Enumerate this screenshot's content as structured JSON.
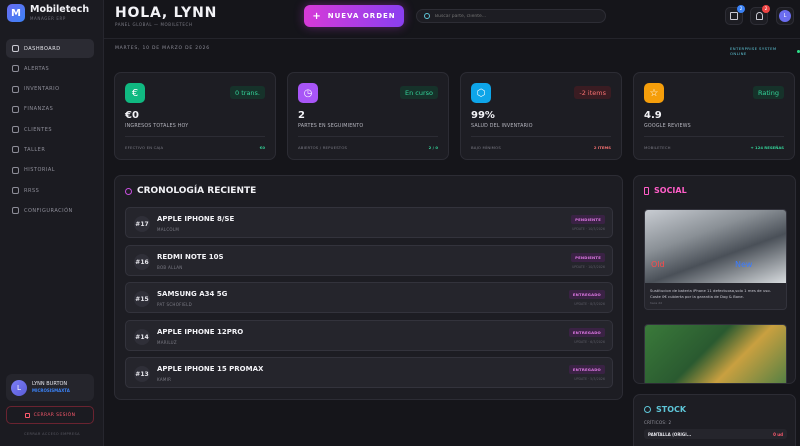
{
  "brand": {
    "logo_letter": "M",
    "name": "Mobiletech",
    "subtitle": "MANAGER ERP"
  },
  "sidebar": {
    "items": [
      {
        "label": "DASHBOARD",
        "icon": "grid-icon",
        "active": true
      },
      {
        "label": "ALERTAS",
        "icon": "bell-icon",
        "active": false
      },
      {
        "label": "INVENTARIO",
        "icon": "box-icon",
        "active": false
      },
      {
        "label": "FINANZAS",
        "icon": "euro-icon",
        "active": false
      },
      {
        "label": "CLIENTES",
        "icon": "users-icon",
        "active": false
      },
      {
        "label": "TALLER",
        "icon": "wrench-icon",
        "active": false
      },
      {
        "label": "HISTORIAL",
        "icon": "history-icon",
        "active": false
      },
      {
        "label": "RRSS",
        "icon": "share-icon",
        "active": false
      },
      {
        "label": "CONFIGURACIÓN",
        "icon": "gear-icon",
        "active": false
      }
    ],
    "user": {
      "initial": "L",
      "name": "LYNN BURTON",
      "role": "MICROSISMAXTA"
    },
    "logout_label": "CERRAR SESIÓN",
    "footnote": "CERRAR ACCESO EMPRESA"
  },
  "header": {
    "greeting": "HOLA, LYNN",
    "subgreeting": "PANEL GLOBAL — MOBILETECH",
    "new_order_label": "NUEVA ORDEN",
    "search_placeholder": "Buscar parte, cliente...",
    "calendar_badge": "2",
    "bell_badge": "2",
    "avatar_initial": "L",
    "date": "MARTES, 10 DE MARZO DE 2026",
    "system_status": "ENTERPRISE SYSTEM ONLINE",
    "colors": {
      "calendar_badge": "#3b82f6",
      "bell_badge": "#ef4444"
    }
  },
  "stats": [
    {
      "icon": "euro-icon",
      "icon_glyph": "€",
      "icon_color": "#10b981",
      "pill": "0 trans.",
      "pill_bg": "#16322a",
      "pill_color": "#34d399",
      "value": "€0",
      "label": "INGRESOS TOTALES HOY",
      "foot": "EFECTIVO EN CAJA",
      "foot_val": "€0",
      "foot_color": "#34d399"
    },
    {
      "icon": "clock-icon",
      "icon_glyph": "◷",
      "icon_color": "#a855f7",
      "pill": "En curso",
      "pill_bg": "#16322a",
      "pill_color": "#34d399",
      "value": "2",
      "label": "PARTES EN SEGUIMIENTO",
      "foot": "ABIERTOS / REPUESTOS",
      "foot_val": "2 / 0",
      "foot_color": "#34d399"
    },
    {
      "icon": "cube-icon",
      "icon_glyph": "⬡",
      "icon_color": "#0ea5e9",
      "pill": "-2 items",
      "pill_bg": "#3a1c22",
      "pill_color": "#f87171",
      "value": "99%",
      "label": "SALUD DEL INVENTARIO",
      "foot": "BAJO MÍNIMOS",
      "foot_val": "2 ITEMS",
      "foot_color": "#f87171"
    },
    {
      "icon": "star-icon",
      "icon_glyph": "☆",
      "icon_color": "#f59e0b",
      "pill": "Rating",
      "pill_bg": "#16322a",
      "pill_color": "#34d399",
      "value": "4.9",
      "label": "GOOGLE REVIEWS",
      "foot": "MOBILETECH",
      "foot_val": "+ 124 RESEÑAS",
      "foot_color": "#34d399"
    }
  ],
  "timeline": {
    "title": "CRONOLOGÍA RECIENTE",
    "orders": [
      {
        "num": "#17",
        "device": "APPLE IPHONE 8/SE",
        "client": "MALCOLM",
        "status": "PENDIENTE",
        "date": "UPDATE · 10/3/2026"
      },
      {
        "num": "#16",
        "device": "REDMI NOTE 10S",
        "client": "BOB ALLAN",
        "status": "PENDIENTE",
        "date": "UPDATE · 10/3/2026"
      },
      {
        "num": "#15",
        "device": "SAMSUNG A34 5G",
        "client": "PAT SCHOFIELD",
        "status": "ENTREGADO",
        "date": "UPDATE · 8/3/2026"
      },
      {
        "num": "#14",
        "device": "APPLE IPHONE 12PRO",
        "client": "MARILUZ",
        "status": "ENTREGADO",
        "date": "UPDATE · 6/3/2026"
      },
      {
        "num": "#13",
        "device": "APPLE IPHONE 15 PROMAX",
        "client": "KAMIR",
        "status": "ENTREGADO",
        "date": "UPDATE · 5/3/2026"
      }
    ]
  },
  "social": {
    "title": "SOCIAL",
    "posts": [
      {
        "img_label_old": "Old",
        "img_label_new": "New",
        "text": "Sustitucion de bateria iPhone 11 defectuosa,solo 1 mes de uso. Coste 0€ cubierta por la garantia de Dog & Bone.",
        "time": "hace 2d"
      },
      {
        "img_label_old": "",
        "img_label_new": "",
        "text": "",
        "time": ""
      }
    ]
  },
  "stock": {
    "title": "STOCK",
    "critical_label": "CRÍTICOS: 2",
    "items": [
      {
        "name": "PANTALLA (ORIGI...",
        "qty": "0 ud"
      }
    ]
  }
}
